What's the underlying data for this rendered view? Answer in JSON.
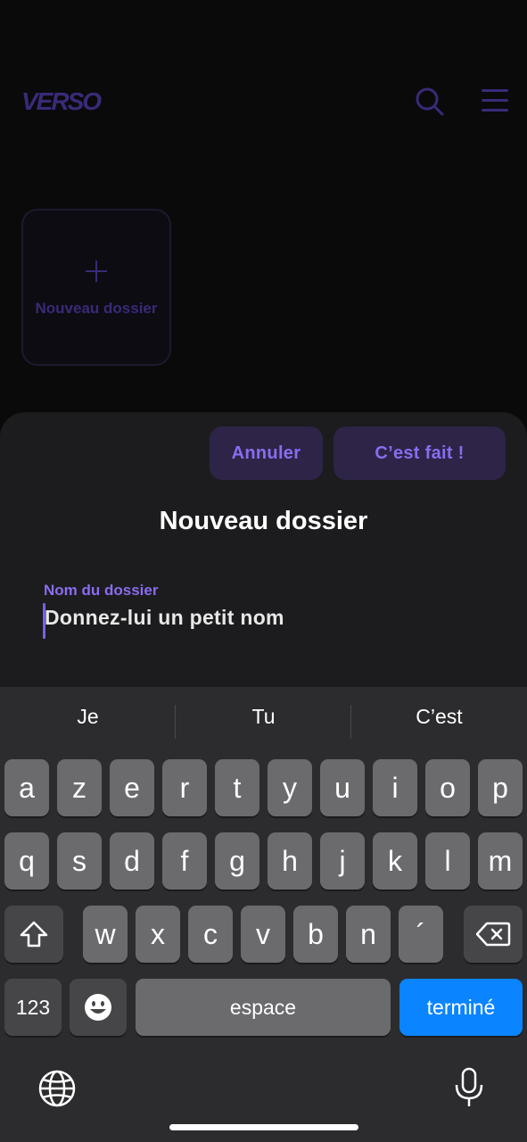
{
  "app": {
    "logo": "VERSO",
    "new_folder_card_label": "Nouveau dossier"
  },
  "sheet": {
    "cancel_label": "Annuler",
    "done_label": "C’est fait !",
    "title": "Nouveau dossier",
    "field_label": "Nom du dossier",
    "field_placeholder": "Donnez-lui un petit nom",
    "field_value": ""
  },
  "keyboard": {
    "suggestions": [
      "Je",
      "Tu",
      "C’est"
    ],
    "row1": [
      "a",
      "z",
      "e",
      "r",
      "t",
      "y",
      "u",
      "i",
      "o",
      "p"
    ],
    "row2": [
      "q",
      "s",
      "d",
      "f",
      "g",
      "h",
      "j",
      "k",
      "l",
      "m"
    ],
    "row3": [
      "w",
      "x",
      "c",
      "v",
      "b",
      "n",
      "´"
    ],
    "numbers_label": "123",
    "space_label": "espace",
    "return_label": "terminé"
  },
  "colors": {
    "accent": "#8a6cf0",
    "dim_accent": "#3a2a78",
    "return_key": "#0a84ff"
  }
}
